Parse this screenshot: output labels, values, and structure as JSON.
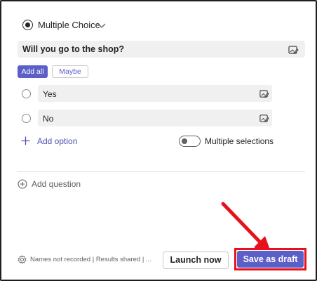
{
  "question": {
    "type_label": "Multiple Choice",
    "text": "Will you go to the shop?"
  },
  "quick_buttons": {
    "add_all": "Add all",
    "maybe": "Maybe"
  },
  "options": [
    {
      "label": "Yes"
    },
    {
      "label": "No"
    }
  ],
  "add_option_label": "Add option",
  "multiple_selections": {
    "label": "Multiple selections",
    "enabled": false
  },
  "add_question_label": "Add question",
  "footer": {
    "settings_text": "Names not recorded | Results shared | ...",
    "launch_label": "Launch now",
    "save_label": "Save as draft"
  },
  "colors": {
    "accent": "#5b5fc7",
    "highlight": "#e8101b",
    "link": "#4f52b2"
  },
  "icons": {
    "question_type": "radio-selected-icon",
    "type_dropdown": "chevron-down-icon",
    "edit": "edit-image-icon",
    "add_option": "plus-icon",
    "add_question": "plus-circle-icon",
    "settings": "gear-icon",
    "annotation": "red-arrow-icon"
  }
}
